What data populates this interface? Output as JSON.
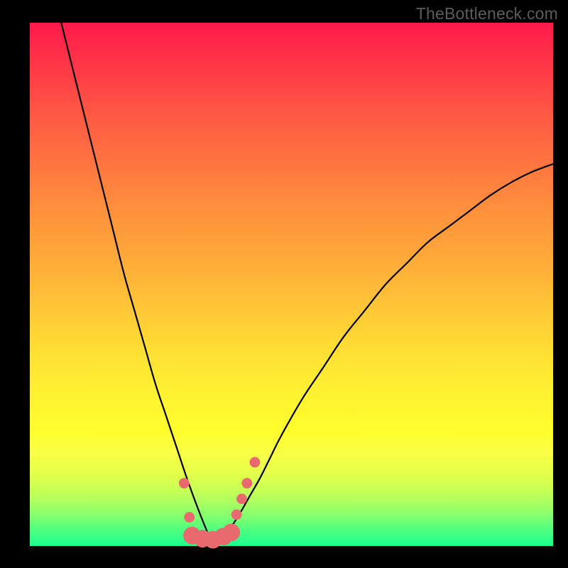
{
  "watermark": "TheBottleneck.com",
  "colors": {
    "frame": "#000000",
    "curve": "#000000",
    "marker_fill": "#e86a6f",
    "marker_stroke": "#e86a6f"
  },
  "chart_data": {
    "type": "line",
    "title": "",
    "xlabel": "",
    "ylabel": "",
    "xlim": [
      0,
      100
    ],
    "ylim": [
      0,
      100
    ],
    "grid": false,
    "series": [
      {
        "name": "bottleneck-curve",
        "description": "V-shaped bottleneck curve; minimum near x≈35 at y≈0",
        "x": [
          6,
          8,
          10,
          12,
          14,
          16,
          18,
          20,
          22,
          24,
          26,
          28,
          30,
          32,
          34,
          35,
          36,
          38,
          40,
          42,
          44,
          46,
          48,
          52,
          56,
          60,
          64,
          68,
          72,
          76,
          80,
          84,
          88,
          92,
          96,
          100
        ],
        "y": [
          100,
          92,
          84,
          76,
          68,
          60,
          52,
          45,
          38,
          31,
          25,
          19,
          13,
          7.5,
          2.5,
          0.5,
          1,
          3,
          6,
          9.5,
          13,
          17,
          21,
          28,
          34,
          40,
          45,
          50,
          54,
          58,
          61,
          64,
          67,
          69.5,
          71.5,
          73
        ]
      }
    ],
    "markers": [
      {
        "x": 29.5,
        "y": 12,
        "r": 1.2
      },
      {
        "x": 30.5,
        "y": 5.5,
        "r": 1.2
      },
      {
        "x": 31.0,
        "y": 2.0,
        "r": 2.0
      },
      {
        "x": 33.0,
        "y": 1.4,
        "r": 2.0
      },
      {
        "x": 35.0,
        "y": 1.2,
        "r": 2.0
      },
      {
        "x": 37.0,
        "y": 1.8,
        "r": 2.0
      },
      {
        "x": 38.5,
        "y": 2.6,
        "r": 2.0
      },
      {
        "x": 39.5,
        "y": 6.0,
        "r": 1.2
      },
      {
        "x": 40.5,
        "y": 9.0,
        "r": 1.2
      },
      {
        "x": 41.5,
        "y": 12.0,
        "r": 1.2
      },
      {
        "x": 43.0,
        "y": 16.0,
        "r": 1.2
      }
    ]
  }
}
